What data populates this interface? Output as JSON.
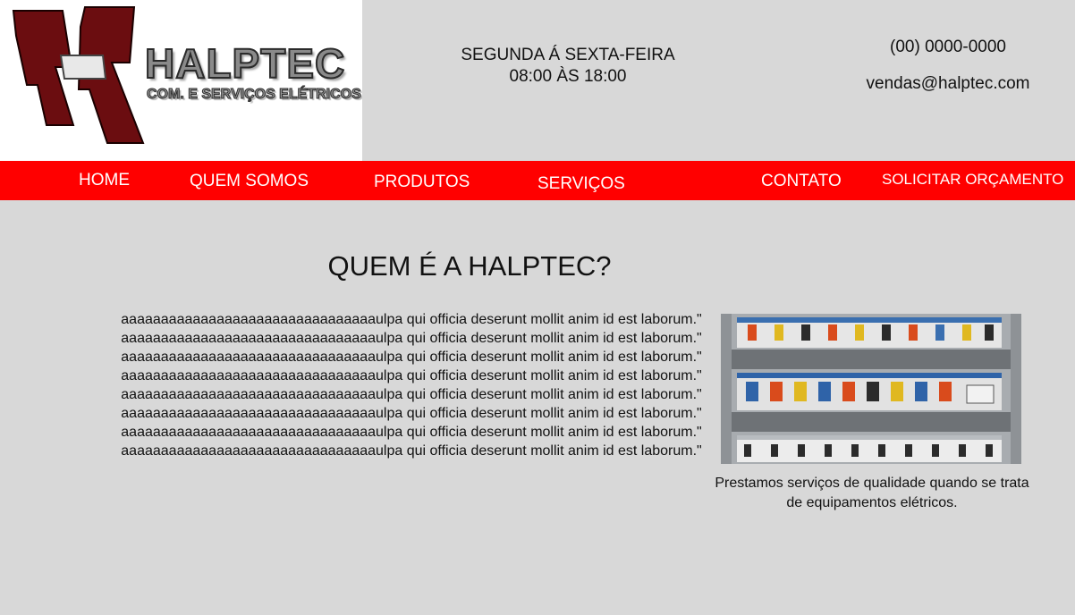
{
  "brand": {
    "name": "HALPTEC",
    "tagline": "COM. E SERVIÇOS ELÉTRICOS",
    "accent_color": "#ff0000",
    "logo_color": "#6b0d10"
  },
  "header": {
    "hours_days": "SEGUNDA Á SEXTA-FEIRA",
    "hours_time": "08:00 ÀS 18:00",
    "phone": "(00) 0000-0000",
    "email": "vendas@halptec.com"
  },
  "nav": {
    "items": [
      {
        "label": "HOME"
      },
      {
        "label": "QUEM SOMOS"
      },
      {
        "label": "PRODUTOS"
      },
      {
        "label": "SERVIÇOS"
      },
      {
        "label": "CONTATO"
      },
      {
        "label": "SOLICITAR ORÇAMENTO"
      }
    ]
  },
  "about": {
    "title": "QUEM É A HALPTEC?",
    "lines": [
      "aaaaaaaaaaaaaaaaaaaaaaaaaaaaaaaaulpa qui officia deserunt mollit anim id est laborum.\"",
      "aaaaaaaaaaaaaaaaaaaaaaaaaaaaaaaaulpa qui officia deserunt mollit anim id est laborum.\"",
      "aaaaaaaaaaaaaaaaaaaaaaaaaaaaaaaaulpa qui officia deserunt mollit anim id est laborum.\"",
      "aaaaaaaaaaaaaaaaaaaaaaaaaaaaaaaaulpa qui officia deserunt mollit anim id est laborum.\"",
      "aaaaaaaaaaaaaaaaaaaaaaaaaaaaaaaaulpa qui officia deserunt mollit anim id est laborum.\"",
      "aaaaaaaaaaaaaaaaaaaaaaaaaaaaaaaaulpa qui officia deserunt mollit anim id est laborum.\"",
      "aaaaaaaaaaaaaaaaaaaaaaaaaaaaaaaaulpa qui officia deserunt mollit anim id est laborum.\"",
      "aaaaaaaaaaaaaaaaaaaaaaaaaaaaaaaaulpa qui officia deserunt mollit anim id est laborum.\""
    ],
    "image_caption_line1": "Prestamos serviços de qualidade quando se trata",
    "image_caption_line2": "de equipamentos elétricos."
  }
}
